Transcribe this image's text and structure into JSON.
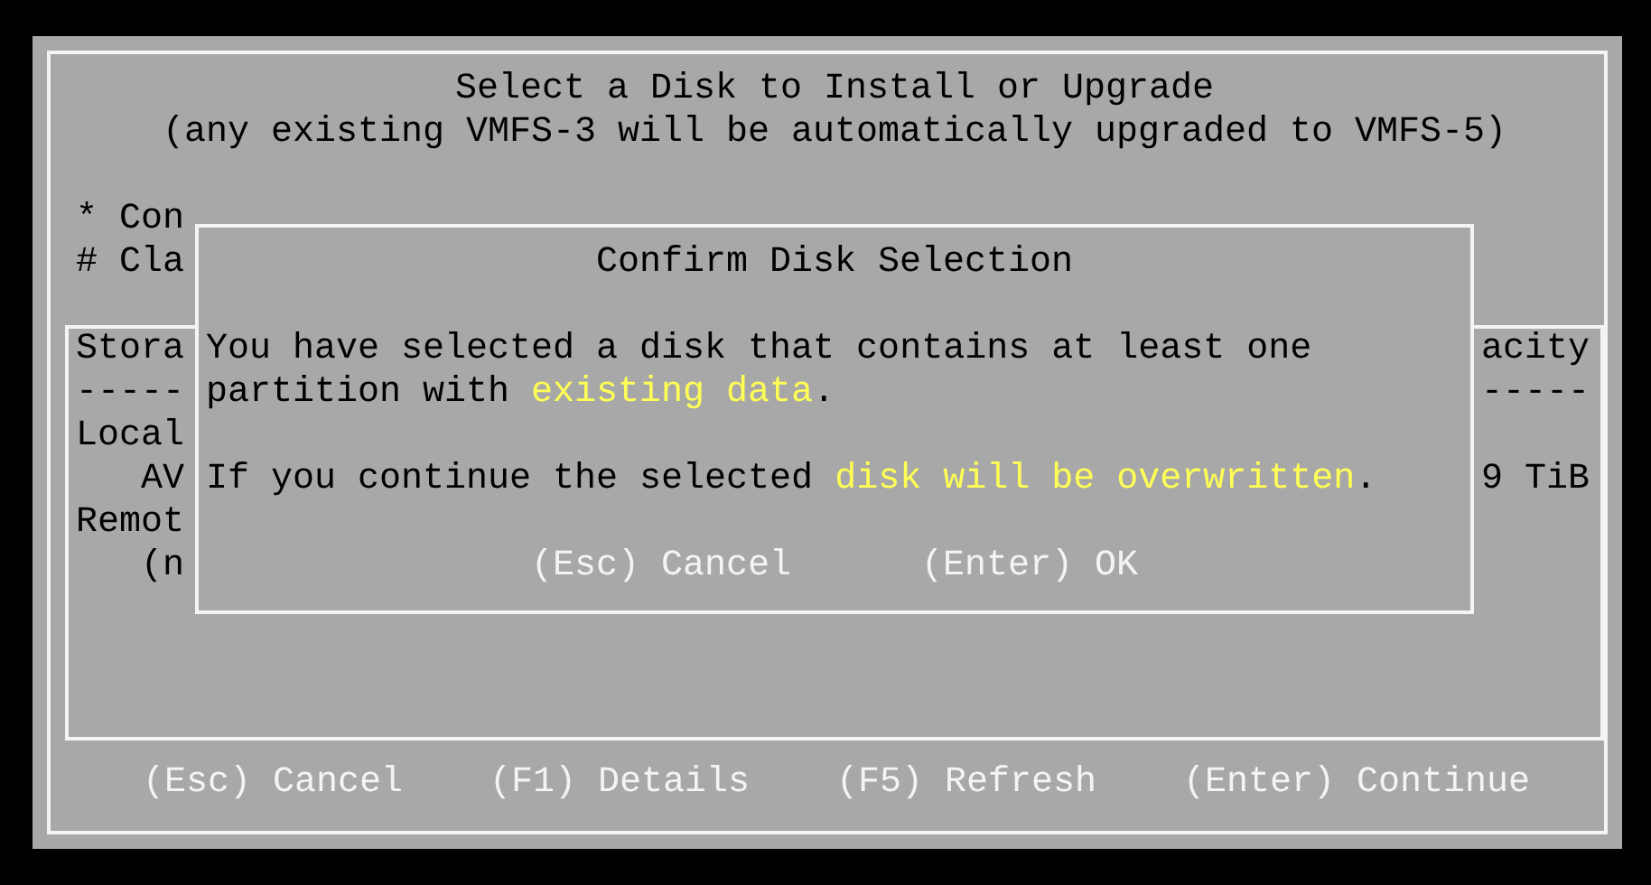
{
  "screen": {
    "title_lines": [
      "Select a Disk to Install or Upgrade",
      "(any existing VMFS-3 will be automatically upgraded to VMFS-5)"
    ],
    "notes": [
      "* Con",
      "# Cla"
    ],
    "storage_table": {
      "rows": [
        {
          "kind": "header",
          "left": "Stora",
          "right": "acity"
        },
        {
          "kind": "rule",
          "left": "-----",
          "right": "-----"
        },
        {
          "kind": "group",
          "left": "Local"
        },
        {
          "kind": "item",
          "left": "AV",
          "right": "9 TiB"
        },
        {
          "kind": "group",
          "left": "Remot"
        },
        {
          "kind": "item",
          "left": "(n"
        }
      ]
    },
    "footer_keys": [
      "(Esc) Cancel",
      "(F1) Details",
      "(F5) Refresh",
      "(Enter) Continue"
    ]
  },
  "dialog": {
    "title": "Confirm Disk Selection",
    "paragraphs": [
      {
        "lines": [
          [
            {
              "text": "You have selected a disk that contains at least one",
              "highlight": false
            }
          ],
          [
            {
              "text": "partition with ",
              "highlight": false
            },
            {
              "text": "existing data",
              "highlight": true
            },
            {
              "text": ".",
              "highlight": false
            }
          ]
        ]
      },
      {
        "lines": [
          [
            {
              "text": "If you continue the selected ",
              "highlight": false
            },
            {
              "text": "disk will be overwritten",
              "highlight": true
            },
            {
              "text": ".",
              "highlight": false
            }
          ]
        ]
      }
    ],
    "buttons": [
      "(Esc) Cancel",
      "(Enter) OK"
    ]
  }
}
